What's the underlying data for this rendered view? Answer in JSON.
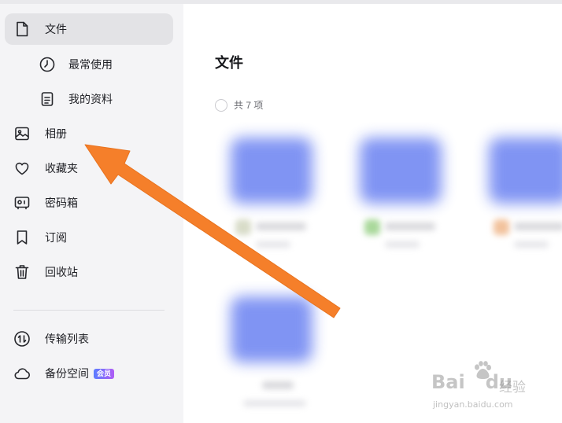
{
  "sidebar": {
    "items": [
      {
        "label": "文件",
        "icon": "file-icon",
        "active": true
      },
      {
        "label": "最常使用",
        "icon": "clock-icon"
      },
      {
        "label": "我的资料",
        "icon": "document-icon"
      },
      {
        "label": "相册",
        "icon": "photo-icon"
      },
      {
        "label": "收藏夹",
        "icon": "heart-icon"
      },
      {
        "label": "密码箱",
        "icon": "safe-icon"
      },
      {
        "label": "订阅",
        "icon": "bookmark-icon"
      },
      {
        "label": "回收站",
        "icon": "trash-icon"
      },
      {
        "label": "传输列表",
        "icon": "transfer-icon"
      },
      {
        "label": "备份空间",
        "icon": "cloud-icon",
        "badge": "会员"
      }
    ]
  },
  "main": {
    "title": "文件",
    "item_count": "共 7 项"
  },
  "colors": {
    "sidebar_bg": "#f4f4f6",
    "active_bg": "#e3e3e6",
    "folder": "#7a8ff3",
    "arrow": "#f57f2a",
    "badge_gradient": [
      "#5b7dff",
      "#b05cf5"
    ]
  },
  "watermark": {
    "brand": "Bai",
    "brand_suffix": "du",
    "cn": "经验",
    "url": "jingyan.baidu.com"
  }
}
